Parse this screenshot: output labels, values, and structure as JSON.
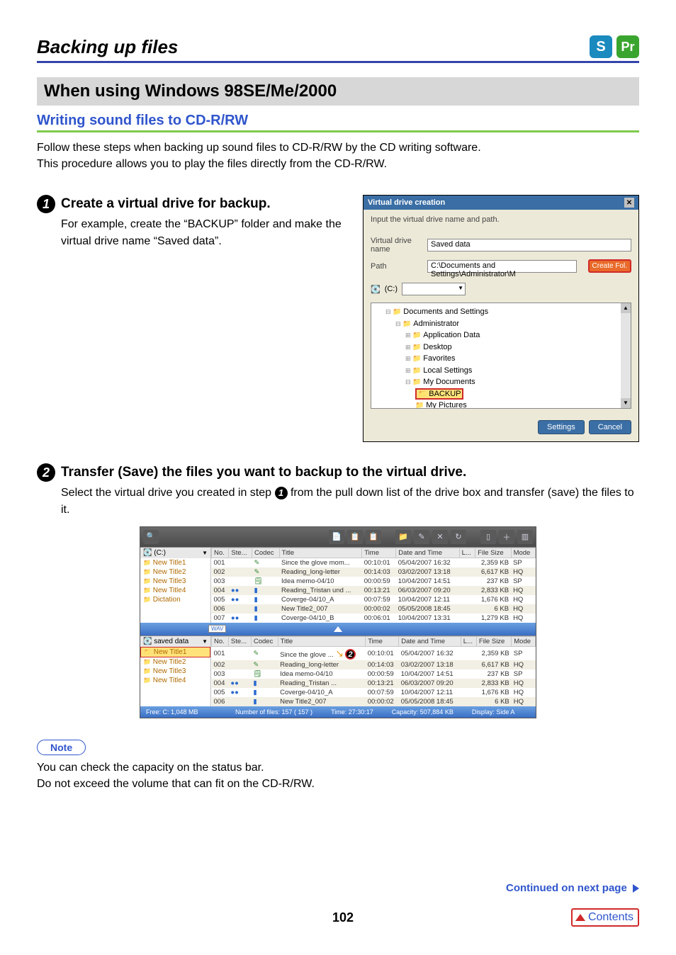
{
  "header": {
    "title": "Backing up files",
    "icon_s": "S",
    "icon_pr": "Pr"
  },
  "section_title": "When using Windows 98SE/Me/2000",
  "sub_heading": "Writing sound files to CD-R/RW",
  "intro_line1": "Follow these steps when backing up sound files to CD-R/RW by the CD writing software.",
  "intro_line2": "This procedure allows you to play the files directly from the CD-R/RW.",
  "step1": {
    "num": "1",
    "title": "Create a virtual drive for backup.",
    "body": "For example, create the “BACKUP” folder and make the virtual drive name “Saved data”."
  },
  "vdc": {
    "title": "Virtual drive creation",
    "instruction": "Input the virtual drive name and path.",
    "name_label": "Virtual drive name",
    "name_value": "Saved data",
    "path_label": "Path",
    "path_value": "C:\\Documents and Settings\\Administrator\\M",
    "create_btn": "Create Fol.",
    "drive_label": "(C:)",
    "tree": {
      "n0": "Documents and Settings",
      "n1": "Administrator",
      "n2": "Application Data",
      "n3": "Desktop",
      "n4": "Favorites",
      "n5": "Local Settings",
      "n6": "My Documents",
      "n7": "BACKUP",
      "n8": "My Pictures"
    },
    "settings_btn": "Settings",
    "cancel_btn": "Cancel"
  },
  "step2": {
    "num": "2",
    "title": "Transfer (Save) the files you want to backup to the virtual drive.",
    "body_pre": "Select the virtual drive you created in step ",
    "body_inline": "1",
    "body_post": " from the pull down list of the drive box and transfer (save) the files to it."
  },
  "app": {
    "top_drive": "(C:)",
    "top_folders": [
      "New Title1",
      "New Title2",
      "New Title3",
      "New Title4",
      "Dictation"
    ],
    "bot_drive": "saved data",
    "bot_folders": [
      "New Title1",
      "New Title2",
      "New Title3",
      "New Title4"
    ],
    "wav_label": "WAV",
    "cols": [
      "No.",
      "Ste...",
      "Codec",
      "Title",
      "Time",
      "Date and Time",
      "L...",
      "File Size",
      "Mode"
    ],
    "rows_top": [
      {
        "no": "001",
        "ste": "",
        "codec": "mic",
        "title": "Since the glove mom...",
        "time": "00:10:01",
        "dt": "05/04/2007 16:32",
        "l": "",
        "size": "2,359 KB",
        "mode": "SP"
      },
      {
        "no": "002",
        "ste": "",
        "codec": "mic",
        "title": "Reading_long-letter",
        "time": "00:14:03",
        "dt": "03/02/2007 13:18",
        "l": "",
        "size": "6,617 KB",
        "mode": "HQ"
      },
      {
        "no": "003",
        "ste": "",
        "codec": "stk",
        "title": "Idea memo-04/10",
        "time": "00:00:59",
        "dt": "10/04/2007 14:51",
        "l": "",
        "size": "237 KB",
        "mode": "SP"
      },
      {
        "no": "004",
        "ste": "●●",
        "codec": "spk",
        "title": "Reading_Tristan und ...",
        "time": "00:13:21",
        "dt": "06/03/2007 09:20",
        "l": "",
        "size": "2,833 KB",
        "mode": "HQ"
      },
      {
        "no": "005",
        "ste": "●●",
        "codec": "spk",
        "title": "Coverge-04/10_A",
        "time": "00:07:59",
        "dt": "10/04/2007 12:11",
        "l": "",
        "size": "1,676 KB",
        "mode": "HQ"
      },
      {
        "no": "006",
        "ste": "",
        "codec": "spk",
        "title": "New Title2_007",
        "time": "00:00:02",
        "dt": "05/05/2008 18:45",
        "l": "",
        "size": "6 KB",
        "mode": "HQ"
      },
      {
        "no": "007",
        "ste": "●●",
        "codec": "spk",
        "title": "Coverge-04/10_B",
        "time": "00:06:01",
        "dt": "10/04/2007 13:31",
        "l": "",
        "size": "1,279 KB",
        "mode": "HQ"
      }
    ],
    "rows_bot": [
      {
        "no": "001",
        "ste": "",
        "codec": "mic",
        "title": "Since the glove ...",
        "time": "00:10:01",
        "dt": "05/04/2007 16:32",
        "l": "",
        "size": "2,359 KB",
        "mode": "SP"
      },
      {
        "no": "002",
        "ste": "",
        "codec": "mic",
        "title": "Reading_long-letter",
        "time": "00:14:03",
        "dt": "03/02/2007 13:18",
        "l": "",
        "size": "6,617 KB",
        "mode": "HQ"
      },
      {
        "no": "003",
        "ste": "",
        "codec": "stk",
        "title": "Idea memo-04/10",
        "time": "00:00:59",
        "dt": "10/04/2007 14:51",
        "l": "",
        "size": "237 KB",
        "mode": "SP"
      },
      {
        "no": "004",
        "ste": "●●",
        "codec": "spk",
        "title": "Reading_Tristan ...",
        "time": "00:13:21",
        "dt": "06/03/2007 09:20",
        "l": "",
        "size": "2,833 KB",
        "mode": "HQ"
      },
      {
        "no": "005",
        "ste": "●●",
        "codec": "spk",
        "title": "Coverge-04/10_A",
        "time": "00:07:59",
        "dt": "10/04/2007 12:11",
        "l": "",
        "size": "1,676 KB",
        "mode": "HQ"
      },
      {
        "no": "006",
        "ste": "",
        "codec": "spk",
        "title": "New Title2_007",
        "time": "00:00:02",
        "dt": "05/05/2008 18:45",
        "l": "",
        "size": "6 KB",
        "mode": "HQ"
      }
    ],
    "badge2": "2",
    "status": {
      "free": "Free: C: 1,048 MB",
      "count": "Number of files: 157 ( 157 )",
      "time": "Time: 27:30:17",
      "cap": "Capacity:    507,884 KB",
      "disp": "Display:  Side A"
    }
  },
  "note": {
    "label": "Note",
    "line1": "You can check the capacity on the status bar.",
    "line2": "Do not exceed the volume that can fit on the CD-R/RW."
  },
  "footer": {
    "continued": "Continued on next page",
    "page": "102",
    "contents": "Contents"
  }
}
